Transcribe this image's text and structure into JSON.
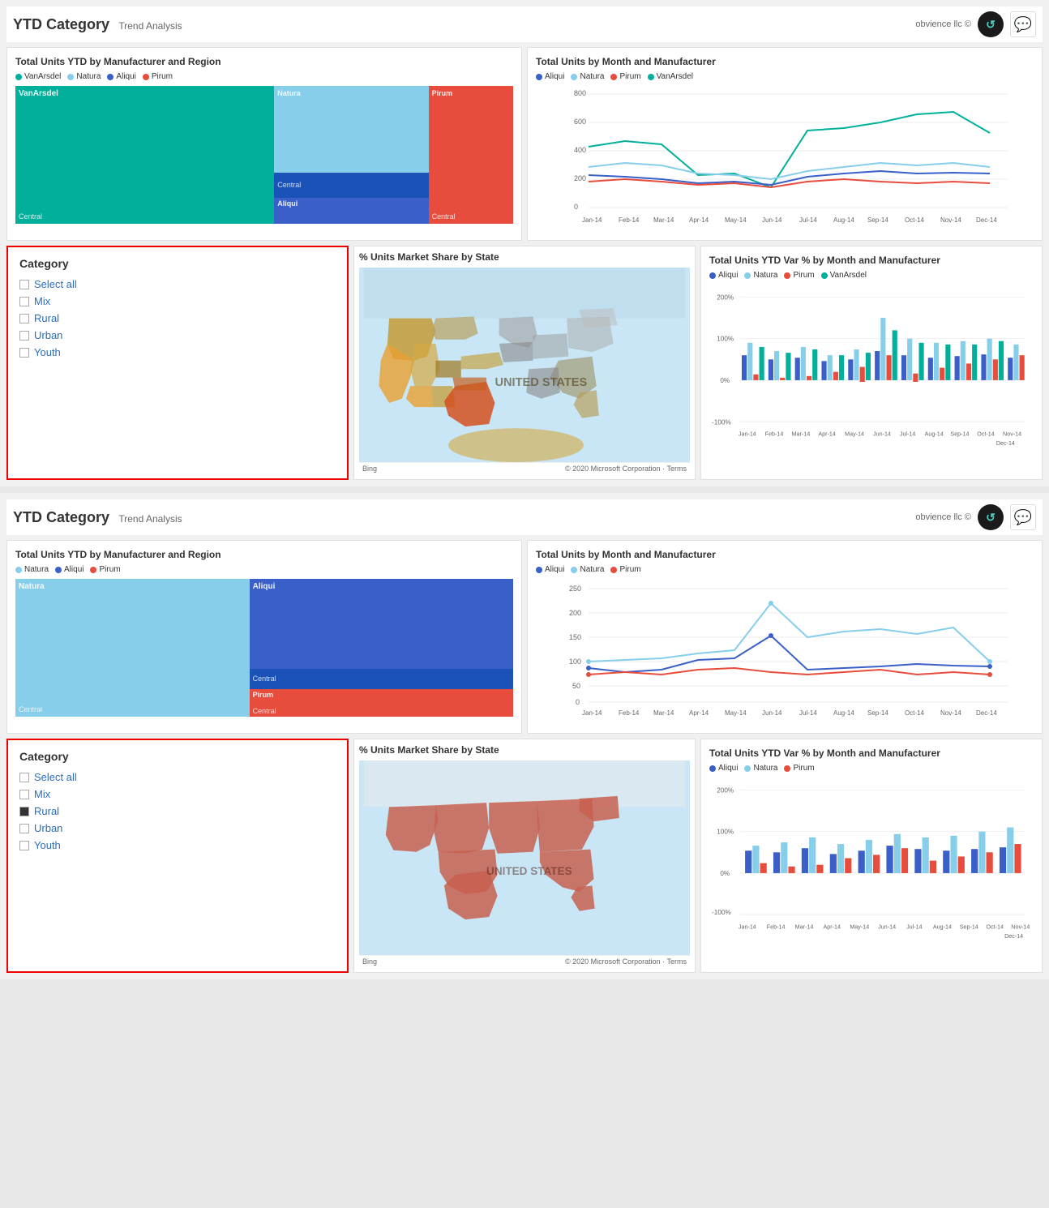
{
  "pages": [
    {
      "id": "page1",
      "header": {
        "title": "YTD Category",
        "subtitle": "Trend Analysis",
        "brand": "obvience llc ©"
      },
      "topLeft": {
        "title": "Total Units YTD by Manufacturer and Region",
        "legend": [
          {
            "label": "VanArsdel",
            "color": "#00b09b"
          },
          {
            "label": "Natura",
            "color": "#87ceeb"
          },
          {
            "label": "Aliqui",
            "color": "#3a5fc8"
          },
          {
            "label": "Pirum",
            "color": "#e74c3c"
          }
        ],
        "labels": {
          "vanarsdel": "VanArsdel",
          "natura": "Natura",
          "pirum": "Pirum",
          "central1": "Central",
          "central2": "Central",
          "central3": "Central",
          "aliqui": "Aliqui"
        }
      },
      "topRight": {
        "title": "Total Units by Month and Manufacturer",
        "legend": [
          {
            "label": "Aliqui",
            "color": "#3a5fc8"
          },
          {
            "label": "Natura",
            "color": "#87ceeb"
          },
          {
            "label": "Pirum",
            "color": "#e74c3c"
          },
          {
            "label": "VanArsdel",
            "color": "#00b09b"
          }
        ],
        "yAxis": [
          "800",
          "600",
          "400",
          "200",
          "0"
        ],
        "xAxis": [
          "Jan-14",
          "Feb-14",
          "Mar-14",
          "Apr-14",
          "May-14",
          "Jun-14",
          "Jul-14",
          "Aug-14",
          "Sep-14",
          "Oct-14",
          "Nov-14",
          "Dec-14"
        ]
      },
      "bottomLeft": {
        "title": "Category",
        "items": [
          {
            "label": "Select all",
            "checked": false
          },
          {
            "label": "Mix",
            "checked": false
          },
          {
            "label": "Rural",
            "checked": false
          },
          {
            "label": "Urban",
            "checked": false
          },
          {
            "label": "Youth",
            "checked": false
          }
        ]
      },
      "bottomCenter": {
        "title": "% Units Market Share by State",
        "footer_left": "Bing",
        "footer_right": "© 2020 Microsoft Corporation · Terms"
      },
      "bottomRight": {
        "title": "Total Units YTD Var % by Month and Manufacturer",
        "legend": [
          {
            "label": "Aliqui",
            "color": "#3a5fc8"
          },
          {
            "label": "Natura",
            "color": "#87ceeb"
          },
          {
            "label": "Pirum",
            "color": "#e74c3c"
          },
          {
            "label": "VanArsdel",
            "color": "#00b09b"
          }
        ],
        "yAxis": [
          "200%",
          "100%",
          "0%",
          "-100%"
        ],
        "xAxis": [
          "Jan-14",
          "Feb-14",
          "Mar-14",
          "Apr-14",
          "May-14",
          "Jun-14",
          "Jul-14",
          "Aug-14",
          "Sep-14",
          "Oct-14",
          "Nov-14",
          "Dec-14"
        ]
      }
    },
    {
      "id": "page2",
      "header": {
        "title": "YTD Category",
        "subtitle": "Trend Analysis",
        "brand": "obvience llc ©"
      },
      "topLeft": {
        "title": "Total Units YTD by Manufacturer and Region",
        "legend": [
          {
            "label": "Natura",
            "color": "#87ceeb"
          },
          {
            "label": "Aliqui",
            "color": "#3a5fc8"
          },
          {
            "label": "Pirum",
            "color": "#e74c3c"
          }
        ],
        "labels": {
          "natura": "Natura",
          "aliqui": "Aliqui",
          "pirum": "Pirum",
          "central1": "Central",
          "central2": "Central"
        }
      },
      "topRight": {
        "title": "Total Units by Month and Manufacturer",
        "legend": [
          {
            "label": "Aliqui",
            "color": "#3a5fc8"
          },
          {
            "label": "Natura",
            "color": "#87ceeb"
          },
          {
            "label": "Pirum",
            "color": "#e74c3c"
          }
        ],
        "yAxis": [
          "250",
          "200",
          "150",
          "100",
          "50",
          "0"
        ],
        "xAxis": [
          "Jan-14",
          "Feb-14",
          "Mar-14",
          "Apr-14",
          "May-14",
          "Jun-14",
          "Jul-14",
          "Aug-14",
          "Sep-14",
          "Oct-14",
          "Nov-14",
          "Dec-14"
        ]
      },
      "bottomLeft": {
        "title": "Category",
        "items": [
          {
            "label": "Select all",
            "checked": false
          },
          {
            "label": "Mix",
            "checked": false
          },
          {
            "label": "Rural",
            "checked": true
          },
          {
            "label": "Urban",
            "checked": false
          },
          {
            "label": "Youth",
            "checked": false
          }
        ]
      },
      "bottomCenter": {
        "title": "% Units Market Share by State",
        "footer_left": "Bing",
        "footer_right": "© 2020 Microsoft Corporation · Terms"
      },
      "bottomRight": {
        "title": "Total Units YTD Var % by Month and Manufacturer",
        "legend": [
          {
            "label": "Aliqui",
            "color": "#3a5fc8"
          },
          {
            "label": "Natura",
            "color": "#87ceeb"
          },
          {
            "label": "Pirum",
            "color": "#e74c3c"
          }
        ],
        "yAxis": [
          "200%",
          "100%",
          "0%",
          "-100%"
        ],
        "xAxis": [
          "Jan-14",
          "Feb-14",
          "Mar-14",
          "Apr-14",
          "May-14",
          "Jun-14",
          "Jul-14",
          "Aug-14",
          "Sep-14",
          "Oct-14",
          "Nov-14",
          "Dec-14"
        ]
      }
    }
  ]
}
